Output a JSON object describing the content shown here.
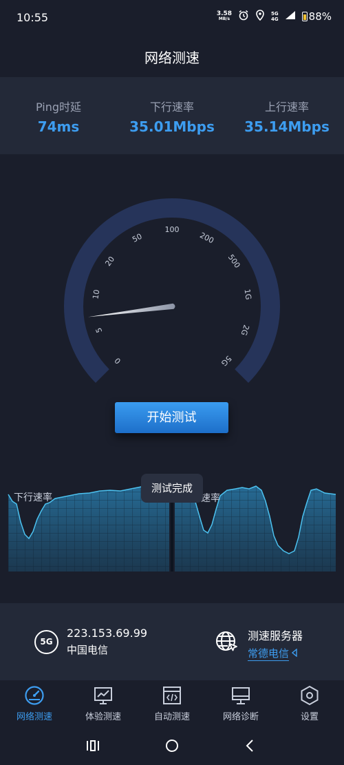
{
  "status_bar": {
    "time": "10:55",
    "net_speed": "3.58",
    "net_speed_unit": "MB/s",
    "net_type_top": "5G",
    "net_type_bottom": "4G",
    "battery": "88%"
  },
  "header": {
    "title": "网络测速"
  },
  "stats": {
    "ping_label": "Ping时延",
    "ping_value": "74ms",
    "download_label": "下行速率",
    "download_value": "35.01Mbps",
    "upload_label": "上行速率",
    "upload_value": "35.14Mbps"
  },
  "gauge": {
    "ticks": [
      "0",
      "5",
      "10",
      "20",
      "50",
      "100",
      "200",
      "500",
      "1G",
      "2G",
      "5G"
    ],
    "needle_fraction": 0.14
  },
  "start_button": {
    "label": "开始测试"
  },
  "waveform": {
    "download_label": "下行速率",
    "upload_label": "速率",
    "status_badge": "测试完成"
  },
  "network_info": {
    "badge": "5G",
    "ip": "223.153.69.99",
    "isp": "中国电信",
    "server_label": "测速服务器",
    "server_name": "常德电信"
  },
  "bottom_nav": {
    "items": [
      {
        "label": "网络测速",
        "icon": "speedometer-icon"
      },
      {
        "label": "体验测速",
        "icon": "chart-monitor-icon"
      },
      {
        "label": "自动测速",
        "icon": "code-window-icon"
      },
      {
        "label": "网络诊断",
        "icon": "monitor-icon"
      },
      {
        "label": "设置",
        "icon": "hexagon-settings-icon"
      }
    ],
    "active_index": 0
  },
  "colors": {
    "accent": "#3d9df0",
    "background": "#1a1e2b",
    "panel": "#232938"
  }
}
